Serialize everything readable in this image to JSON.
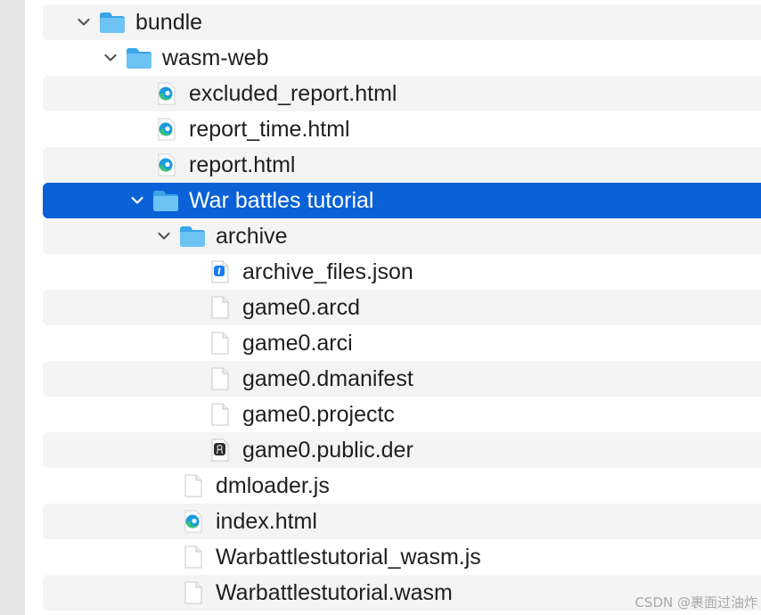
{
  "rows": [
    {
      "label": "bundle",
      "icon": "folder-icon",
      "depth": 0,
      "expanded": true,
      "selected": false,
      "stripe": true
    },
    {
      "label": "wasm-web",
      "icon": "folder-icon",
      "depth": 1,
      "expanded": true,
      "selected": false,
      "stripe": false
    },
    {
      "label": "excluded_report.html",
      "icon": "edge-html-icon",
      "depth": 2,
      "selected": false,
      "stripe": true
    },
    {
      "label": "report_time.html",
      "icon": "edge-html-icon",
      "depth": 2,
      "selected": false,
      "stripe": false
    },
    {
      "label": "report.html",
      "icon": "edge-html-icon",
      "depth": 2,
      "selected": false,
      "stripe": true
    },
    {
      "label": "War battles tutorial",
      "icon": "folder-icon",
      "depth": 2,
      "expanded": true,
      "selected": true,
      "stripe": false
    },
    {
      "label": "archive",
      "icon": "folder-icon",
      "depth": 3,
      "expanded": true,
      "selected": false,
      "stripe": true
    },
    {
      "label": "archive_files.json",
      "icon": "json-file-icon",
      "depth": 4,
      "selected": false,
      "stripe": false
    },
    {
      "label": "game0.arcd",
      "icon": "blank-file-icon",
      "depth": 4,
      "selected": false,
      "stripe": true
    },
    {
      "label": "game0.arci",
      "icon": "blank-file-icon",
      "depth": 4,
      "selected": false,
      "stripe": false
    },
    {
      "label": "game0.dmanifest",
      "icon": "blank-file-icon",
      "depth": 4,
      "selected": false,
      "stripe": true
    },
    {
      "label": "game0.projectc",
      "icon": "blank-file-icon",
      "depth": 4,
      "selected": false,
      "stripe": false
    },
    {
      "label": "game0.public.der",
      "icon": "certificate-file-icon",
      "depth": 4,
      "selected": false,
      "stripe": true
    },
    {
      "label": "dmloader.js",
      "icon": "blank-file-icon",
      "depth": 3,
      "selected": false,
      "stripe": false
    },
    {
      "label": "index.html",
      "icon": "edge-html-icon",
      "depth": 3,
      "selected": false,
      "stripe": true
    },
    {
      "label": "Warbattlestutorial_wasm.js",
      "icon": "blank-file-icon",
      "depth": 3,
      "selected": false,
      "stripe": false
    },
    {
      "label": "Warbattlestutorial.wasm",
      "icon": "blank-file-icon",
      "depth": 3,
      "selected": false,
      "stripe": true
    }
  ],
  "watermark": "CSDN @裹面过油炸",
  "colors": {
    "selection": "#0a61d8",
    "stripe": "#f4f4f4",
    "folder": "#5ab8f0",
    "text": "#1f1f1f"
  }
}
